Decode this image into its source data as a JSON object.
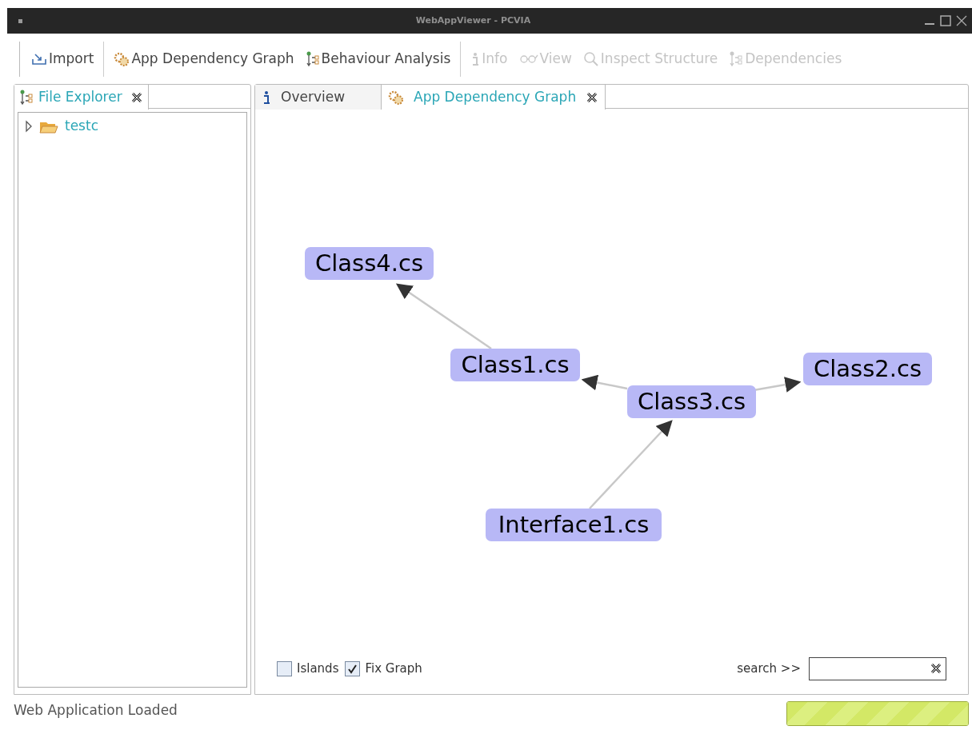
{
  "window": {
    "title": "WebAppViewer - PCVIA"
  },
  "toolbar": [
    {
      "kind": "import",
      "label": "Import",
      "disabled": false
    },
    {
      "kind": "gears",
      "label": "App Dependency Graph",
      "disabled": false
    },
    {
      "kind": "tree",
      "label": "Behaviour Analysis",
      "disabled": false
    },
    {
      "kind": "info",
      "label": "Info",
      "disabled": true
    },
    {
      "kind": "view",
      "label": "View",
      "disabled": true
    },
    {
      "kind": "search",
      "label": "Inspect Structure",
      "disabled": true
    },
    {
      "kind": "tree",
      "label": "Dependencies",
      "disabled": true
    }
  ],
  "left_panel": {
    "tab": {
      "label": "File Explorer",
      "selected": true
    },
    "tree": [
      {
        "label": "testc",
        "expanded": false
      }
    ]
  },
  "editor_tabs": [
    {
      "kind": "info",
      "label": "Overview",
      "selected": false,
      "closable": false
    },
    {
      "kind": "gears",
      "label": "App Dependency Graph",
      "selected": true,
      "closable": true
    }
  ],
  "graph": {
    "nodes": [
      {
        "label": "Class4.cs"
      },
      {
        "label": "Class1.cs"
      },
      {
        "label": "Class2.cs"
      },
      {
        "label": "Class3.cs"
      },
      {
        "label": "Interface1.cs"
      }
    ],
    "options": [
      {
        "label": "Islands",
        "checked": false
      },
      {
        "label": "Fix Graph",
        "checked": true
      }
    ],
    "search": {
      "label": "search >>"
    }
  },
  "status_bar": {
    "message": "Web Application Loaded",
    "progress": {
      "level": 1
    }
  }
}
